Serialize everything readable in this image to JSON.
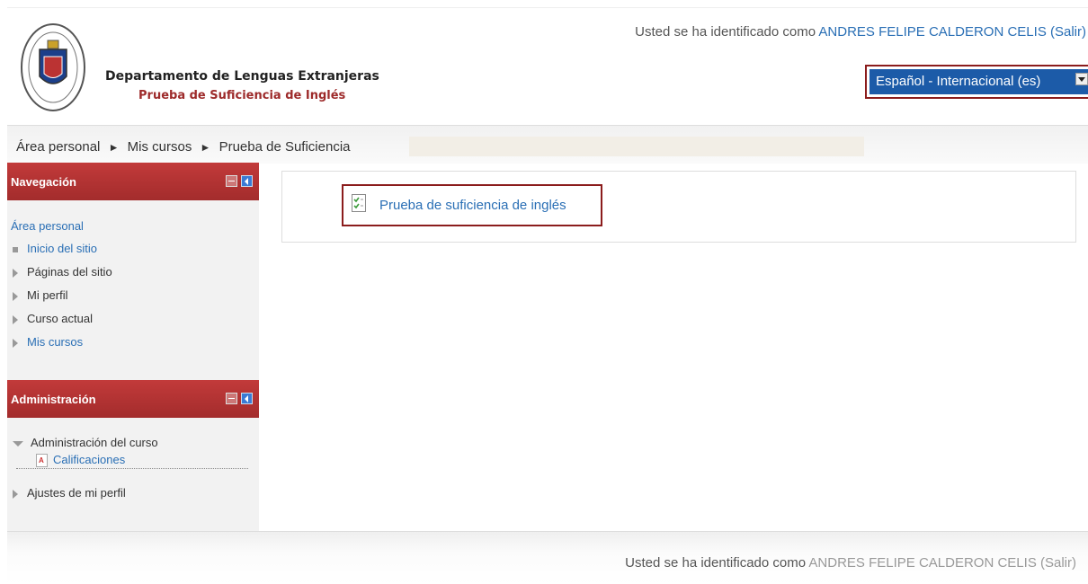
{
  "header": {
    "department": "Departamento de Lenguas Extranjeras",
    "subtitle": "Prueba de Suficiencia de Inglés",
    "login_prefix": "Usted se ha identificado como",
    "user_name": "ANDRES FELIPE CALDERON CELIS",
    "logout_label": "(Salir)",
    "language": "Español - Internacional (es)"
  },
  "breadcrumb": {
    "items": [
      "Área personal",
      "Mis cursos",
      "Prueba de Suficiencia"
    ],
    "separator": "►"
  },
  "navigation_block": {
    "title": "Navegación",
    "home_link": "Área personal",
    "items": [
      {
        "label": "Inicio del sitio",
        "icon": "bullet-icon",
        "is_link": true
      },
      {
        "label": "Páginas del sitio",
        "icon": "expand-arrow-icon",
        "is_link": false
      },
      {
        "label": "Mi perfil",
        "icon": "expand-arrow-icon",
        "is_link": false
      },
      {
        "label": "Curso actual",
        "icon": "expand-arrow-icon",
        "is_link": false
      },
      {
        "label": "Mis cursos",
        "icon": "expand-arrow-icon",
        "is_link": true
      }
    ]
  },
  "administration_block": {
    "title": "Administración",
    "course_admin_label": "Administración del curso",
    "grades_label": "Calificaciones",
    "profile_settings_label": "Ajustes de mi perfil"
  },
  "main": {
    "activity_label": "Prueba de suficiencia de inglés",
    "activity_icon": "quiz-icon"
  },
  "footer": {
    "login_prefix": "Usted se ha identificado como",
    "user_name": "ANDRES FELIPE CALDERON CELIS",
    "logout_label": "(Salir)"
  },
  "colors": {
    "block_header": "#a32c2c",
    "link": "#2a6fb5",
    "highlight_border": "#8b1c1c",
    "language_bg": "#1c5ba8"
  }
}
